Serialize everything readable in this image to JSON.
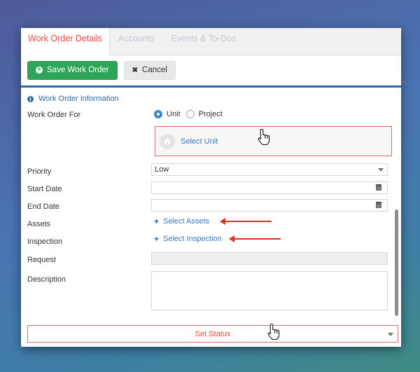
{
  "tabs": [
    {
      "label": "Work Order Details",
      "active": true
    },
    {
      "label": "Accounts",
      "active": false
    },
    {
      "label": "Events & To-Dos",
      "active": false
    }
  ],
  "toolbar": {
    "save_label": "Save Work Order",
    "save_icon": "plus-circle-icon",
    "cancel_label": "Cancel",
    "cancel_icon": "x-icon"
  },
  "section": {
    "title": "Work Order Information",
    "icon": "info-icon"
  },
  "form": {
    "work_order_for": {
      "label": "Work Order For",
      "options": [
        "Unit",
        "Project"
      ],
      "selected": "Unit"
    },
    "select_unit": {
      "label": "Select Unit",
      "icon": "home-icon"
    },
    "priority": {
      "label": "Priority",
      "value": "Low"
    },
    "start_date": {
      "label": "Start Date",
      "value": ""
    },
    "end_date": {
      "label": "End Date",
      "value": ""
    },
    "assets": {
      "label": "Assets",
      "link": "Select Assets"
    },
    "inspection": {
      "label": "Inspection",
      "link": "Select Inspection"
    },
    "request": {
      "label": "Request",
      "value": ""
    },
    "description": {
      "label": "Description",
      "value": ""
    },
    "status": {
      "label": "Set Status"
    }
  },
  "colors": {
    "accent_blue": "#2b6aa3",
    "save_green": "#2fa55a",
    "active_tab_red": "#e2473b",
    "highlight_border": "#e8636b",
    "annotation_arrow": "#e52b1e"
  }
}
